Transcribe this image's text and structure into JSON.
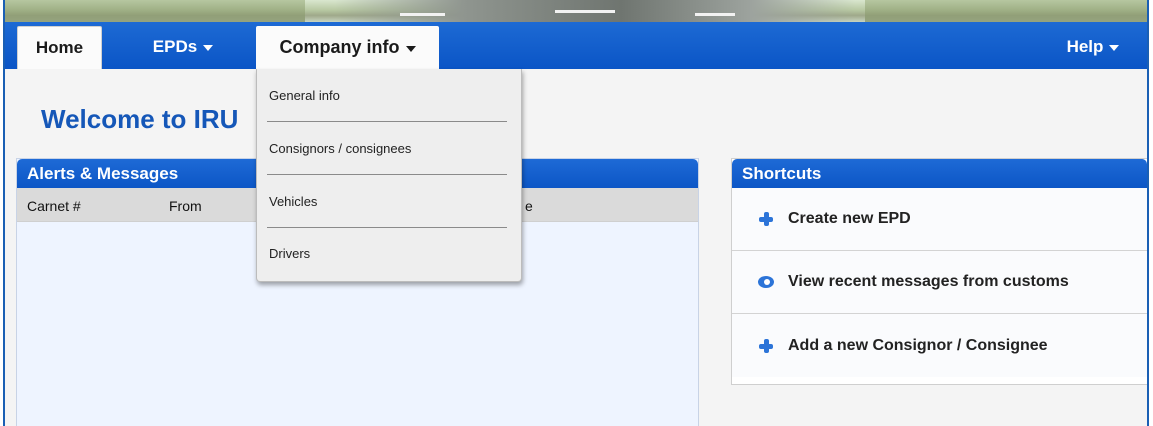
{
  "nav": {
    "home": "Home",
    "epds": "EPDs",
    "company_info": "Company info",
    "help": "Help"
  },
  "dropdown": {
    "items": [
      "General info",
      "Consignors / consignees",
      "Vehicles",
      "Drivers"
    ]
  },
  "welcome": "Welcome to IRU",
  "alerts": {
    "title": "Alerts & Messages",
    "columns": [
      "Carnet #",
      "From",
      "e"
    ]
  },
  "shortcuts": {
    "title": "Shortcuts",
    "items": [
      {
        "label": "Create new EPD",
        "icon": "plus-icon"
      },
      {
        "label": "View recent messages from customs",
        "icon": "eye-icon"
      },
      {
        "label": "Add a new Consignor / Consignee",
        "icon": "plus-icon"
      }
    ]
  },
  "colors": {
    "brand_blue": "#0b55c6",
    "title_blue": "#1557b8",
    "icon_blue": "#2c74d8"
  }
}
